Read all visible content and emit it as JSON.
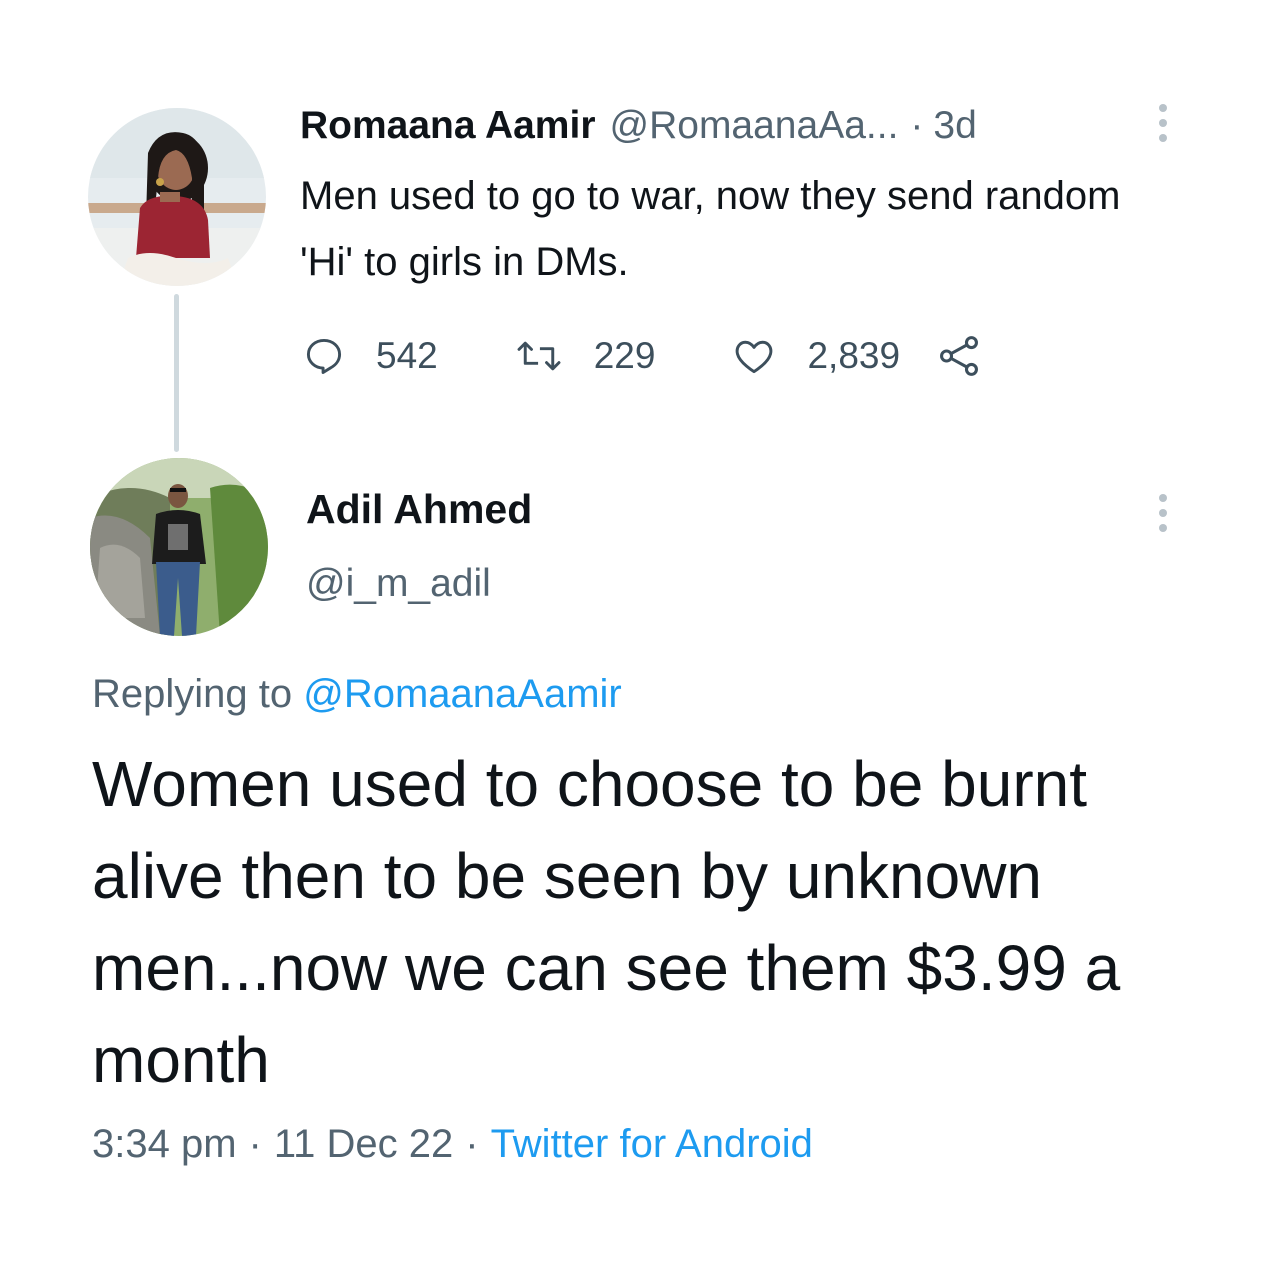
{
  "original_tweet": {
    "author_name": "Romaana Aamir",
    "author_handle": "@RomaanaAa...",
    "separator": "·",
    "age": "3d",
    "text": "Men used to go to war, now they send random 'Hi' to girls in DMs.",
    "stats": {
      "replies": "542",
      "retweets": "229",
      "likes": "2,839"
    }
  },
  "reply_tweet": {
    "author_name": "Adil Ahmed",
    "author_handle": "@i_m_adil",
    "replying_prefix": "Replying to",
    "replying_to": "@RomaanaAamir",
    "text": "Women used to choose to be burnt alive then to be seen by unknown men...now we can see them $3.99 a month",
    "time": "3:34 pm",
    "separator": "·",
    "date": "11 Dec 22",
    "source": "Twitter for Android"
  },
  "icons": {
    "reply": "reply-icon",
    "retweet": "retweet-icon",
    "like": "heart-icon",
    "share": "share-icon",
    "more": "more-options-icon"
  },
  "colors": {
    "text_primary": "#0f1419",
    "text_secondary": "#536471",
    "link": "#1d9bf0",
    "thread_line": "#cfd9de"
  }
}
